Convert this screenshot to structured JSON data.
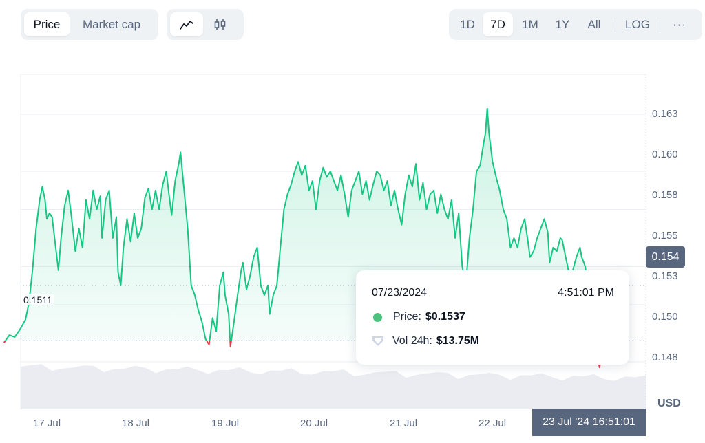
{
  "toolbar": {
    "metric_tabs": [
      {
        "label": "Price",
        "active": true
      },
      {
        "label": "Market cap",
        "active": false
      }
    ],
    "chart_types": [
      {
        "icon": "line-chart-icon",
        "active": true
      },
      {
        "icon": "candlestick-icon",
        "active": false
      }
    ],
    "ranges": [
      {
        "label": "1D",
        "active": false
      },
      {
        "label": "7D",
        "active": true
      },
      {
        "label": "1M",
        "active": false
      },
      {
        "label": "1Y",
        "active": false
      },
      {
        "label": "All",
        "active": false
      }
    ],
    "log_label": "LOG",
    "more_label": "···"
  },
  "colors": {
    "up": "#16c784",
    "down": "#ea3943",
    "axis_text": "#58667e",
    "label_bg": "#58667e"
  },
  "chart": {
    "open_price_label": "0.1511",
    "current_price_label": "0.154",
    "currency_label": "USD",
    "crosshair_time": "23 Jul '24 16:51:01",
    "y_ticks": [
      "0.163",
      "0.160",
      "0.158",
      "0.155",
      "0.153",
      "0.150",
      "0.148"
    ],
    "x_ticks": [
      "17 Jul",
      "18 Jul",
      "19 Jul",
      "20 Jul",
      "21 Jul",
      "22 Jul"
    ]
  },
  "tooltip": {
    "date": "07/23/2024",
    "time": "4:51:01 PM",
    "price_label": "Price:",
    "price_value": "$0.1537",
    "volume_label": "Vol 24h:",
    "volume_value": "$13.75M"
  },
  "chart_data": {
    "type": "area",
    "x_unit": "days since 16 Jul 2024 00:00",
    "ylim": [
      0.1475,
      0.1651
    ],
    "reference_open": 0.1511,
    "current": 0.154,
    "points": [
      [
        0.62,
        0.151
      ],
      [
        0.68,
        0.1514
      ],
      [
        0.74,
        0.1513
      ],
      [
        0.8,
        0.1517
      ],
      [
        0.86,
        0.1522
      ],
      [
        0.9,
        0.1531
      ],
      [
        0.94,
        0.1548
      ],
      [
        0.98,
        0.157
      ],
      [
        1.02,
        0.1585
      ],
      [
        1.05,
        0.1592
      ],
      [
        1.08,
        0.1585
      ],
      [
        1.1,
        0.1575
      ],
      [
        1.13,
        0.1578
      ],
      [
        1.16,
        0.1576
      ],
      [
        1.2,
        0.156
      ],
      [
        1.23,
        0.1548
      ],
      [
        1.26,
        0.1565
      ],
      [
        1.3,
        0.1582
      ],
      [
        1.34,
        0.159
      ],
      [
        1.38,
        0.1575
      ],
      [
        1.42,
        0.1558
      ],
      [
        1.46,
        0.157
      ],
      [
        1.5,
        0.156
      ],
      [
        1.54,
        0.1585
      ],
      [
        1.58,
        0.1575
      ],
      [
        1.62,
        0.159
      ],
      [
        1.66,
        0.158
      ],
      [
        1.7,
        0.1587
      ],
      [
        1.72,
        0.1565
      ],
      [
        1.76,
        0.1585
      ],
      [
        1.8,
        0.159
      ],
      [
        1.84,
        0.1565
      ],
      [
        1.88,
        0.1576
      ],
      [
        1.9,
        0.1547
      ],
      [
        1.93,
        0.154
      ],
      [
        1.96,
        0.156
      ],
      [
        2.0,
        0.1575
      ],
      [
        2.04,
        0.1563
      ],
      [
        2.08,
        0.1578
      ],
      [
        2.12,
        0.1565
      ],
      [
        2.16,
        0.157
      ],
      [
        2.2,
        0.1586
      ],
      [
        2.24,
        0.1591
      ],
      [
        2.28,
        0.158
      ],
      [
        2.32,
        0.159
      ],
      [
        2.36,
        0.158
      ],
      [
        2.4,
        0.1593
      ],
      [
        2.44,
        0.16
      ],
      [
        2.47,
        0.1588
      ],
      [
        2.5,
        0.1577
      ],
      [
        2.54,
        0.1595
      ],
      [
        2.58,
        0.1604
      ],
      [
        2.6,
        0.161
      ],
      [
        2.64,
        0.159
      ],
      [
        2.68,
        0.157
      ],
      [
        2.72,
        0.154
      ],
      [
        2.76,
        0.1535
      ],
      [
        2.8,
        0.1527
      ],
      [
        2.84,
        0.1521
      ],
      [
        2.88,
        0.1512
      ],
      [
        2.92,
        0.1509
      ],
      [
        2.96,
        0.1523
      ],
      [
        3.0,
        0.1516
      ],
      [
        3.04,
        0.154
      ],
      [
        3.08,
        0.1547
      ],
      [
        3.1,
        0.1535
      ],
      [
        3.14,
        0.1525
      ],
      [
        3.16,
        0.1508
      ],
      [
        3.2,
        0.1521
      ],
      [
        3.24,
        0.1535
      ],
      [
        3.28,
        0.1548
      ],
      [
        3.3,
        0.1552
      ],
      [
        3.34,
        0.1538
      ],
      [
        3.38,
        0.1545
      ],
      [
        3.42,
        0.1555
      ],
      [
        3.46,
        0.156
      ],
      [
        3.5,
        0.154
      ],
      [
        3.54,
        0.1535
      ],
      [
        3.58,
        0.154
      ],
      [
        3.6,
        0.1525
      ],
      [
        3.64,
        0.1535
      ],
      [
        3.68,
        0.154
      ],
      [
        3.72,
        0.156
      ],
      [
        3.76,
        0.158
      ],
      [
        3.8,
        0.1588
      ],
      [
        3.84,
        0.1593
      ],
      [
        3.88,
        0.16
      ],
      [
        3.92,
        0.1605
      ],
      [
        3.96,
        0.1598
      ],
      [
        4.0,
        0.1603
      ],
      [
        4.04,
        0.159
      ],
      [
        4.08,
        0.1595
      ],
      [
        4.12,
        0.158
      ],
      [
        4.16,
        0.1595
      ],
      [
        4.2,
        0.1602
      ],
      [
        4.24,
        0.1597
      ],
      [
        4.28,
        0.16
      ],
      [
        4.32,
        0.1595
      ],
      [
        4.36,
        0.159
      ],
      [
        4.4,
        0.1598
      ],
      [
        4.44,
        0.1588
      ],
      [
        4.48,
        0.1576
      ],
      [
        4.52,
        0.159
      ],
      [
        4.56,
        0.1595
      ],
      [
        4.6,
        0.16
      ],
      [
        4.64,
        0.1588
      ],
      [
        4.68,
        0.1595
      ],
      [
        4.72,
        0.1585
      ],
      [
        4.76,
        0.1593
      ],
      [
        4.8,
        0.16
      ],
      [
        4.84,
        0.1598
      ],
      [
        4.88,
        0.159
      ],
      [
        4.92,
        0.1595
      ],
      [
        4.96,
        0.1582
      ],
      [
        5.0,
        0.159
      ],
      [
        5.04,
        0.158
      ],
      [
        5.08,
        0.1572
      ],
      [
        5.12,
        0.1588
      ],
      [
        5.16,
        0.1598
      ],
      [
        5.2,
        0.1592
      ],
      [
        5.24,
        0.1604
      ],
      [
        5.28,
        0.1585
      ],
      [
        5.32,
        0.1594
      ],
      [
        5.36,
        0.158
      ],
      [
        5.4,
        0.1588
      ],
      [
        5.44,
        0.159
      ],
      [
        5.48,
        0.1578
      ],
      [
        5.52,
        0.1588
      ],
      [
        5.56,
        0.158
      ],
      [
        5.6,
        0.1575
      ],
      [
        5.64,
        0.1585
      ],
      [
        5.68,
        0.1565
      ],
      [
        5.72,
        0.1578
      ],
      [
        5.76,
        0.155
      ],
      [
        5.8,
        0.154
      ],
      [
        5.84,
        0.1565
      ],
      [
        5.88,
        0.158
      ],
      [
        5.92,
        0.16
      ],
      [
        5.96,
        0.1603
      ],
      [
        6.0,
        0.1615
      ],
      [
        6.02,
        0.162
      ],
      [
        6.04,
        0.1633
      ],
      [
        6.06,
        0.162
      ],
      [
        6.1,
        0.1605
      ],
      [
        6.14,
        0.1597
      ],
      [
        6.18,
        0.159
      ],
      [
        6.22,
        0.158
      ],
      [
        6.26,
        0.1575
      ],
      [
        6.3,
        0.156
      ],
      [
        6.34,
        0.1565
      ],
      [
        6.38,
        0.156
      ],
      [
        6.42,
        0.157
      ],
      [
        6.46,
        0.1575
      ],
      [
        6.5,
        0.1562
      ],
      [
        6.52,
        0.1555
      ],
      [
        6.56,
        0.1558
      ],
      [
        6.6,
        0.1565
      ],
      [
        6.64,
        0.157
      ],
      [
        6.68,
        0.1575
      ],
      [
        6.72,
        0.1568
      ],
      [
        6.74,
        0.1552
      ],
      [
        6.78,
        0.156
      ],
      [
        6.82,
        0.1558
      ],
      [
        6.86,
        0.1565
      ],
      [
        6.88,
        0.1564
      ],
      [
        6.92,
        0.1555
      ],
      [
        6.96,
        0.1546
      ],
      [
        7.0,
        0.1548
      ],
      [
        7.04,
        0.1555
      ],
      [
        7.08,
        0.156
      ],
      [
        7.1,
        0.1555
      ],
      [
        7.14,
        0.155
      ],
      [
        7.18,
        0.1534
      ],
      [
        7.2,
        0.1535
      ],
      [
        7.22,
        0.152
      ],
      [
        7.26,
        0.1505
      ],
      [
        7.3,
        0.1497
      ],
      [
        7.34,
        0.151
      ],
      [
        7.38,
        0.1525
      ],
      [
        7.42,
        0.154
      ],
      [
        7.46,
        0.1544
      ]
    ]
  }
}
